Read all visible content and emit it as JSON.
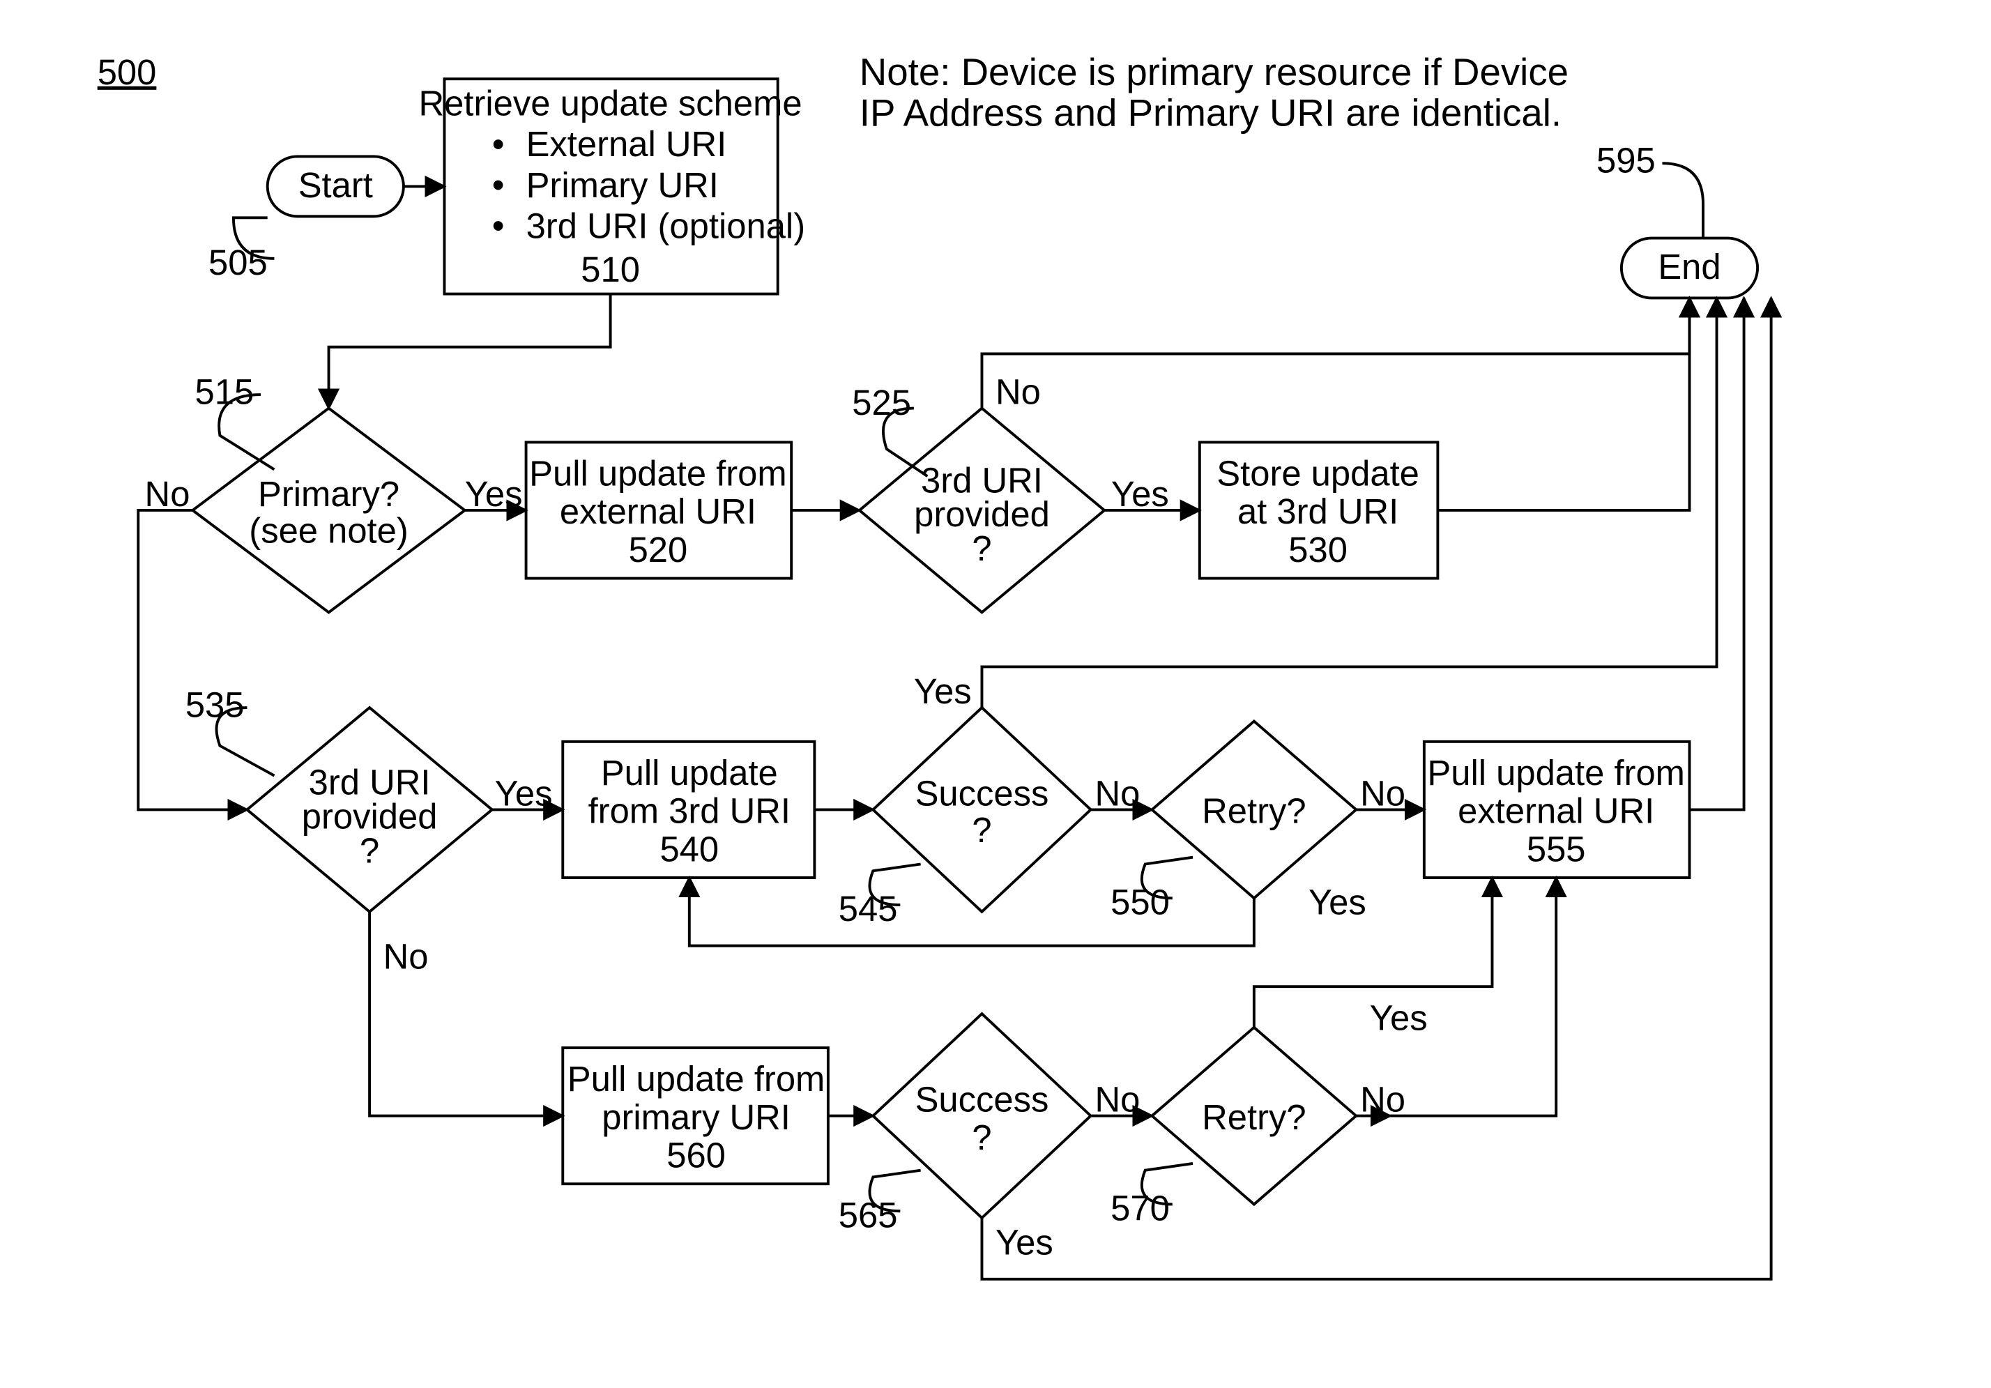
{
  "figure_number": "500",
  "note": {
    "line1": "Note: Device is primary resource if Device",
    "line2": "IP Address and Primary URI are identical."
  },
  "terminators": {
    "start": {
      "text": "Start",
      "ref": "505"
    },
    "end": {
      "text": "End",
      "ref": "595"
    }
  },
  "process": {
    "retrieve": {
      "title": "Retrieve update scheme",
      "bullet1": "External URI",
      "bullet2": "Primary URI",
      "bullet3": "3rd URI (optional)",
      "ref": "510"
    },
    "pull_ext_520": {
      "l1": "Pull update from",
      "l2": "external URI",
      "ref": "520"
    },
    "store_530": {
      "l1": "Store update",
      "l2": "at 3rd URI",
      "ref": "530"
    },
    "pull_3rd_540": {
      "l1": "Pull update",
      "l2": "from 3rd URI",
      "ref": "540"
    },
    "pull_ext_555": {
      "l1": "Pull update from",
      "l2": "external URI",
      "ref": "555"
    },
    "pull_primary_560": {
      "l1": "Pull update from",
      "l2": "primary URI",
      "ref": "560"
    }
  },
  "decision": {
    "primary_515": {
      "l1": "Primary?",
      "l2": "(see note)",
      "ref": "515"
    },
    "uri_525": {
      "l1": "3rd URI",
      "l2": "provided",
      "l3": "?",
      "ref": "525"
    },
    "uri_535": {
      "l1": "3rd URI",
      "l2": "provided",
      "l3": "?",
      "ref": "535"
    },
    "success_545": {
      "l1": "Success",
      "l2": "?",
      "ref": "545"
    },
    "retry_550": {
      "l1": "Retry?",
      "ref": "550"
    },
    "pull_ext555": {
      "f": ""
    },
    "success_565": {
      "l1": "Success",
      "l2": "?",
      "ref": "565"
    },
    "retry_570": {
      "l1": "Retry?",
      "ref": "570"
    }
  },
  "labels": {
    "yes": "Yes",
    "no": "No"
  }
}
